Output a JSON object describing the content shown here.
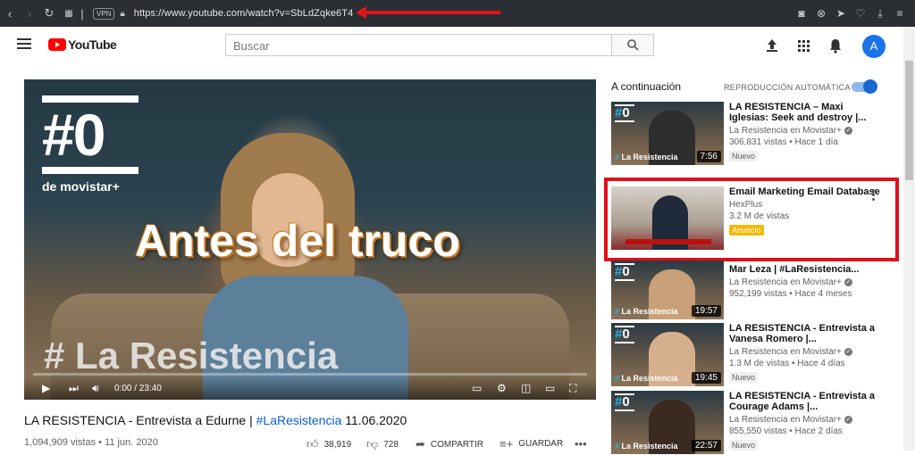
{
  "browser": {
    "url": "https://www.youtube.com/watch?v=SbLdZqke6T4",
    "vpn_label": "VPN"
  },
  "header": {
    "logo_text": "YouTube",
    "search_placeholder": "Buscar",
    "avatar_letter": "A"
  },
  "video": {
    "overlay_text": "Antes del truco",
    "brand_zero": "#0",
    "brand_sub": "de movistar+",
    "watermark": "# La Resistencia",
    "time": "0:00 / 23:40",
    "title_prefix": "LA RESISTENCIA - Entrevista a Edurne | ",
    "title_hashtag": "#LaResistencia",
    "title_suffix": " 11.06.2020",
    "meta": "1,094,909 vistas • 11 jun. 2020",
    "likes": "38,919",
    "dislikes": "728",
    "share_label": "COMPARTIR",
    "save_label": "GUARDAR"
  },
  "sidebar": {
    "up_next": "A continuación",
    "autoplay_label": "REPRODUCCIÓN AUTOMÁTICA",
    "autoplay_on": true,
    "items": [
      {
        "title": "LA RESISTENCIA – Maxi Iglesias: Seek and destroy |...",
        "channel": "La Resistencia en Movistar+",
        "views": "306,831 vistas • Hace 1 día",
        "badge": "Nuevo",
        "duration": "7:56"
      },
      {
        "title": "Email Marketing Email Database",
        "channel": "HexPlus",
        "views": "3.2 M de vistas",
        "badge": "Anuncio"
      },
      {
        "title": "Mar Leza | #LaResistencia...",
        "channel": "La Resistencia en Movistar+",
        "views": "952,199 vistas • Hace 4 meses",
        "duration": "19:57"
      },
      {
        "title": "LA RESISTENCIA - Entrevista a Vanesa Romero |...",
        "channel": "La Resistencia en Movistar+",
        "views": "1.3 M de vistas • Hace 4 días",
        "badge": "Nuevo",
        "duration": "19:45"
      },
      {
        "title": "LA RESISTENCIA - Entrevista a Courage Adams |...",
        "channel": "La Resistencia en Movistar+",
        "views": "855,550 vistas • Hace 2 días",
        "badge": "Nuevo",
        "duration": "22:57"
      }
    ]
  },
  "colors": {
    "annotation_red": "#e20e18",
    "youtube_red": "#ff0000",
    "link_blue": "#065fd4",
    "brand_cyan": "#2ab1e0"
  }
}
